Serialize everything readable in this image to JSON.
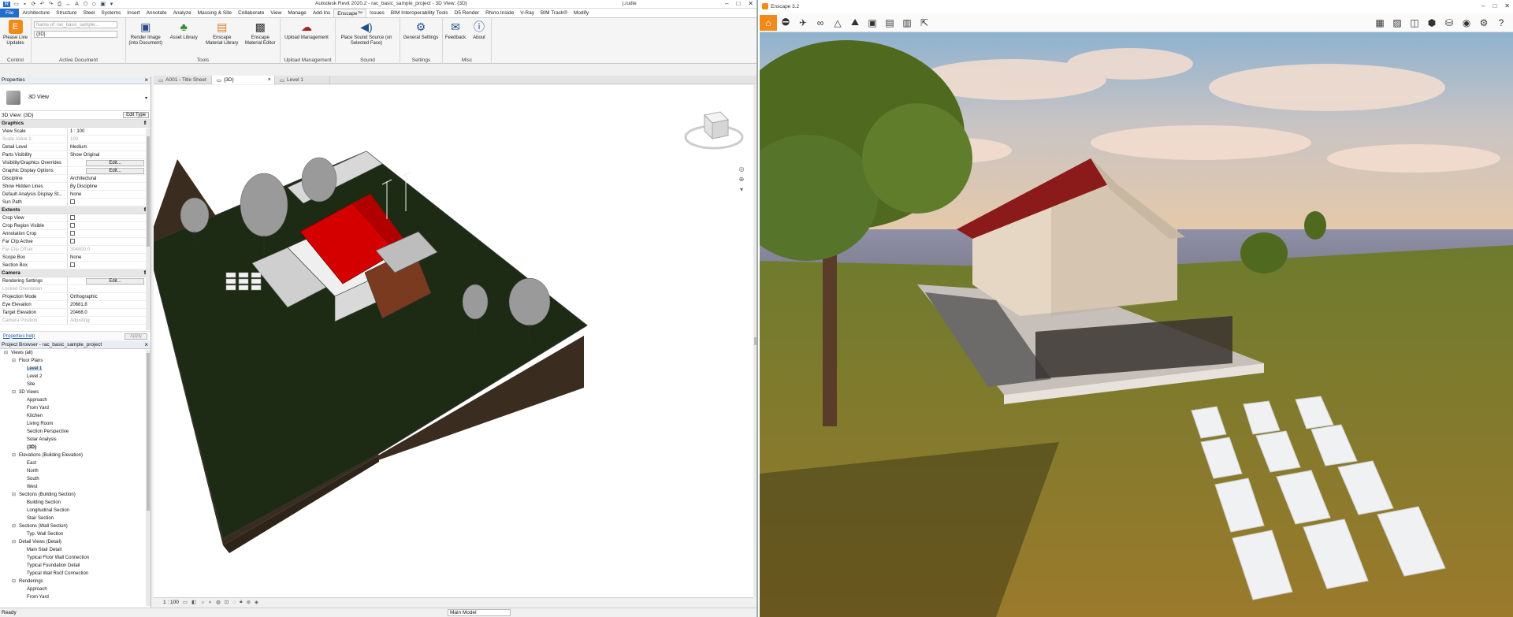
{
  "revit": {
    "app_title": "Autodesk Revit 2020.2 - rac_basic_sample_project - 3D View: {3D}",
    "user": "j.rudie",
    "ribbon_tabs": [
      "File",
      "Architecture",
      "Structure",
      "Steel",
      "Systems",
      "Insert",
      "Annotate",
      "Analyze",
      "Massing & Site",
      "Collaborate",
      "View",
      "Manage",
      "Add-Ins",
      "Enscape™",
      "Issues",
      "BIM Interoperability Tools",
      "D5 Render",
      "Rhino.Inside",
      "V-Ray",
      "BIM Track®",
      "Modify"
    ],
    "active_tab_index": 13,
    "ribbon": {
      "groups": [
        {
          "label": "Control",
          "buttons": [
            {
              "label": "Please Live Updates",
              "icon": "enscape-logo-icon"
            }
          ]
        },
        {
          "label": "Active Document",
          "fields": [
            "Name of: rac_basic_sample...",
            "{3D}"
          ]
        },
        {
          "label": "Tools",
          "buttons": [
            {
              "label": "Render Image (into Document)",
              "icon": "render-icon"
            },
            {
              "label": "Asset Library",
              "icon": "tree-icon"
            },
            {
              "label": "Enscape Material Library",
              "icon": "material-library-icon"
            },
            {
              "label": "Enscape Material Editor",
              "icon": "material-editor-icon"
            }
          ]
        },
        {
          "label": "Upload Management",
          "buttons": [
            {
              "label": "Upload Management",
              "icon": "cloud-upload-icon"
            }
          ]
        },
        {
          "label": "Sound",
          "buttons": [
            {
              "label": "Place Sound Source (on Selected Face)",
              "icon": "speaker-icon"
            }
          ]
        },
        {
          "label": "Settings",
          "buttons": [
            {
              "label": "General Settings",
              "icon": "gear-icon"
            }
          ]
        },
        {
          "label": "Misc",
          "buttons": [
            {
              "label": "Feedback",
              "icon": "mail-icon"
            },
            {
              "label": "About",
              "icon": "info-icon"
            }
          ]
        }
      ]
    },
    "properties": {
      "title": "Properties",
      "type_name": "3D View",
      "filter_value": "3D View: {3D}",
      "edit_type": "Edit Type",
      "categories": [
        {
          "name": "Graphics",
          "rows": [
            {
              "k": "View Scale",
              "v": "1 : 100",
              "type": "text"
            },
            {
              "k": "Scale Value    1:",
              "v": "100",
              "type": "text",
              "gray": true
            },
            {
              "k": "Detail Level",
              "v": "Medium",
              "type": "text"
            },
            {
              "k": "Parts Visibility",
              "v": "Show Original",
              "type": "text"
            },
            {
              "k": "Visibility/Graphics Overrides",
              "v": "Edit...",
              "type": "button"
            },
            {
              "k": "Graphic Display Options",
              "v": "Edit...",
              "type": "button"
            },
            {
              "k": "Discipline",
              "v": "Architectural",
              "type": "text"
            },
            {
              "k": "Show Hidden Lines",
              "v": "By Discipline",
              "type": "text"
            },
            {
              "k": "Default Analysis Display St...",
              "v": "None",
              "type": "text"
            },
            {
              "k": "Sun Path",
              "v": "",
              "type": "check"
            }
          ]
        },
        {
          "name": "Extents",
          "rows": [
            {
              "k": "Crop View",
              "v": "",
              "type": "check"
            },
            {
              "k": "Crop Region Visible",
              "v": "",
              "type": "check"
            },
            {
              "k": "Annotation Crop",
              "v": "",
              "type": "check"
            },
            {
              "k": "Far Clip Active",
              "v": "",
              "type": "check"
            },
            {
              "k": "Far Clip Offset",
              "v": "304800.0",
              "type": "text",
              "gray": true
            },
            {
              "k": "Scope Box",
              "v": "None",
              "type": "text"
            },
            {
              "k": "Section Box",
              "v": "",
              "type": "check"
            }
          ]
        },
        {
          "name": "Camera",
          "rows": [
            {
              "k": "Rendering Settings",
              "v": "Edit...",
              "type": "button"
            },
            {
              "k": "Locked Orientation",
              "v": "",
              "type": "text",
              "gray": true
            },
            {
              "k": "Projection Mode",
              "v": "Orthographic",
              "type": "text"
            },
            {
              "k": "Eye Elevation",
              "v": "20681.8",
              "type": "text"
            },
            {
              "k": "Target Elevation",
              "v": "20468.0",
              "type": "text"
            },
            {
              "k": "Camera Position",
              "v": "Adjusting",
              "type": "text",
              "gray": true
            }
          ]
        }
      ],
      "help_link": "Properties help",
      "apply": "Apply"
    },
    "project_browser": {
      "title": "Project Browser - rac_basic_sample_project",
      "items": [
        {
          "label": "Views (all)",
          "level": 0,
          "toggle": "⊟",
          "bold": false
        },
        {
          "label": "Floor Plans",
          "level": 1,
          "toggle": "⊟"
        },
        {
          "label": "Level 1",
          "level": 2,
          "selected": true
        },
        {
          "label": "Level 2",
          "level": 2
        },
        {
          "label": "Site",
          "level": 2
        },
        {
          "label": "3D Views",
          "level": 1,
          "toggle": "⊟"
        },
        {
          "label": "Approach",
          "level": 2
        },
        {
          "label": "From Yard",
          "level": 2
        },
        {
          "label": "Kitchen",
          "level": 2
        },
        {
          "label": "Living Room",
          "level": 2
        },
        {
          "label": "Section Perspective",
          "level": 2
        },
        {
          "label": "Solar Analysis",
          "level": 2
        },
        {
          "label": "{3D}",
          "level": 2,
          "bold": true
        },
        {
          "label": "Elevations (Building Elevation)",
          "level": 1,
          "toggle": "⊟"
        },
        {
          "label": "East",
          "level": 2
        },
        {
          "label": "North",
          "level": 2
        },
        {
          "label": "South",
          "level": 2
        },
        {
          "label": "West",
          "level": 2
        },
        {
          "label": "Sections (Building Section)",
          "level": 1,
          "toggle": "⊟"
        },
        {
          "label": "Building Section",
          "level": 2
        },
        {
          "label": "Longitudinal Section",
          "level": 2
        },
        {
          "label": "Stair Section",
          "level": 2
        },
        {
          "label": "Sections (Wall Section)",
          "level": 1,
          "toggle": "⊟"
        },
        {
          "label": "Typ. Wall Section",
          "level": 2
        },
        {
          "label": "Detail Views (Detail)",
          "level": 1,
          "toggle": "⊟"
        },
        {
          "label": "Main Stair Detail",
          "level": 2
        },
        {
          "label": "Typical Floor Wall Connection",
          "level": 2
        },
        {
          "label": "Typical Foundation Detail",
          "level": 2
        },
        {
          "label": "Typical Wall Roof Connection",
          "level": 2
        },
        {
          "label": "Renderings",
          "level": 1,
          "toggle": "⊟"
        },
        {
          "label": "Approach",
          "level": 2
        },
        {
          "label": "From Yard",
          "level": 2
        }
      ]
    },
    "view_tabs": [
      {
        "label": "A001 - Title Sheet",
        "active": false
      },
      {
        "label": "{3D}",
        "active": true
      },
      {
        "label": "Level 1",
        "active": false
      }
    ],
    "view_scale": "1 : 100",
    "status": "Ready",
    "model_selector": "Main Model"
  },
  "enscape": {
    "title": "Enscape 3.2",
    "toolbar_icons": [
      "home-icon",
      "walk-icon",
      "fly-icon",
      "binoculars-icon",
      "compass-icon",
      "atmosphere-icon",
      "screenshot-icon",
      "batch-render-icon",
      "panorama-icon",
      "export-icon"
    ],
    "right_icons": [
      "bookmark-icon",
      "image-icon",
      "asset-icon",
      "cube-icon",
      "visibility-icon",
      "view-icon",
      "settings-icon",
      "help-icon"
    ]
  }
}
